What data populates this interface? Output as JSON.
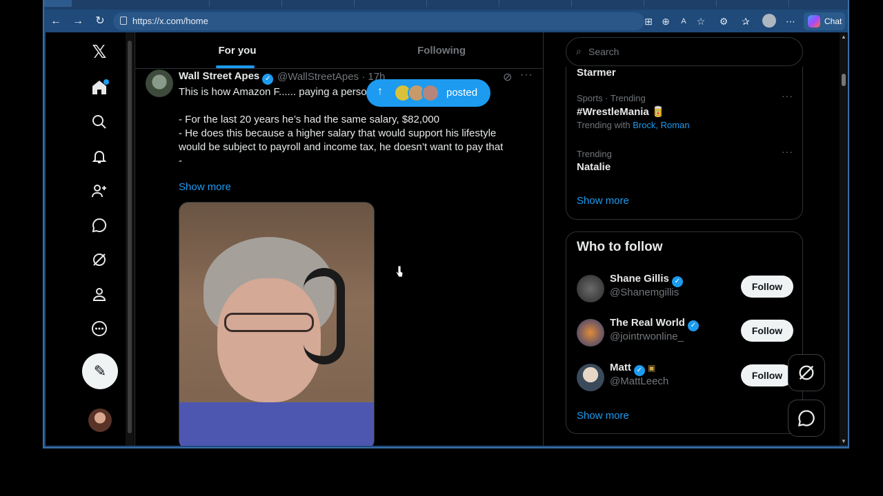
{
  "browser": {
    "url": "https://x.com/home",
    "chat_label": "Chat"
  },
  "feed": {
    "tabs": [
      {
        "label": "For you",
        "active": true
      },
      {
        "label": "Following",
        "active": false
      }
    ],
    "new_posts_label": "posted",
    "tweet": {
      "name": "Wall Street Apes",
      "handle": "@WallStreetApes · 17h",
      "lines": [
        "This is how Amazon F...... paying a personal income tax",
        "",
        "- For the last 20 years he’s had the same salary, $82,000",
        "- He does this because a higher salary that would support his lifestyle would be subject to payroll and income tax, he doesn’t want to pay that",
        "-"
      ],
      "show_more": "Show more"
    }
  },
  "sidebar_right": {
    "search_placeholder": "Search",
    "trend_top_title": "Starmer",
    "trends": [
      {
        "meta": "Sports · Trending",
        "title": "#WrestleMania 🥫",
        "with_prefix": "Trending with",
        "with_names": "Brock, Roman"
      },
      {
        "meta": "Trending",
        "title": "Natalie",
        "with_prefix": "",
        "with_names": ""
      }
    ],
    "trends_show_more": "Show more",
    "who_to_follow": {
      "title": "Who to follow",
      "users": [
        {
          "name": "Shane Gillis",
          "handle": "@Shanemgillis",
          "button": "Follow"
        },
        {
          "name": "The Real World",
          "handle": "@jointrwonline_",
          "button": "Follow"
        },
        {
          "name": "Matt",
          "handle": "@MattLeech",
          "button": "Follow"
        }
      ],
      "show_more": "Show more"
    }
  },
  "icons": [
    "x-logo-icon",
    "home-icon",
    "search-icon",
    "bell-icon",
    "add-person-icon",
    "message-icon",
    "grok-icon",
    "profile-icon",
    "more-icon",
    "compose-icon"
  ],
  "colors": {
    "accent": "#1d9bf0",
    "background": "#000000",
    "browser_chrome": "#1f4a7a"
  }
}
